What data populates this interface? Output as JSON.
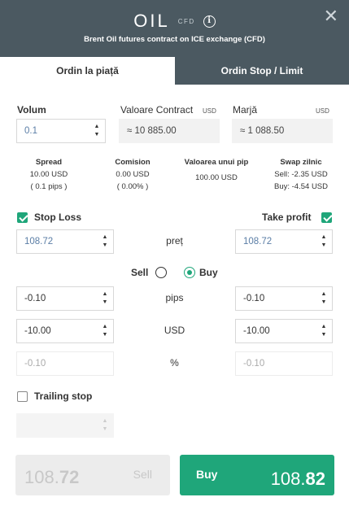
{
  "header": {
    "symbol": "OIL",
    "type_badge": "CFD",
    "info_glyph": "i",
    "subtitle": "Brent Oil futures contract on ICE exchange (CFD)",
    "close_glyph": "✕"
  },
  "tabs": {
    "market": "Ordin la piață",
    "stop_limit": "Ordin Stop / Limit"
  },
  "volume": {
    "label": "Volum",
    "value": "0.1"
  },
  "contract": {
    "label": "Valoare Contract",
    "currency": "USD",
    "value": "≈ 10 885.00"
  },
  "margin": {
    "label": "Marjă",
    "currency": "USD",
    "value": "≈ 1 088.50"
  },
  "stats": {
    "spread": {
      "title": "Spread",
      "line1": "10.00 USD",
      "line2": "( 0.1 pips )"
    },
    "commission": {
      "title": "Comision",
      "line1": "0.00 USD",
      "line2": "( 0.00% )"
    },
    "pip_value": {
      "title": "Valoarea unui pip",
      "line1": "100.00 USD"
    },
    "swap": {
      "title": "Swap zilnic",
      "line1": "Sell: -2.35 USD",
      "line2": "Buy: -4.54 USD"
    }
  },
  "stop_loss": {
    "label": "Stop Loss",
    "checked": true,
    "price": "108.72",
    "pips": "-0.10",
    "usd": "-10.00",
    "percent": "-0.10"
  },
  "take_profit": {
    "label": "Take profit",
    "checked": true,
    "price": "108.72",
    "pips": "-0.10",
    "usd": "-10.00",
    "percent": "-0.10"
  },
  "row_labels": {
    "price": "preț",
    "pips": "pips",
    "usd": "USD",
    "percent": "%"
  },
  "direction": {
    "sell": "Sell",
    "buy": "Buy",
    "selected": "Buy"
  },
  "trailing_stop": {
    "label": "Trailing stop",
    "checked": false,
    "value": ""
  },
  "sell_button": {
    "price_main": "108.",
    "price_bold": "72",
    "label": "Sell"
  },
  "buy_button": {
    "label": "Buy",
    "price_main": "108.",
    "price_bold": "82"
  },
  "colors": {
    "header_bg": "#4b5961",
    "accent_green": "#1fa67a",
    "input_value": "#5b7ea6"
  }
}
